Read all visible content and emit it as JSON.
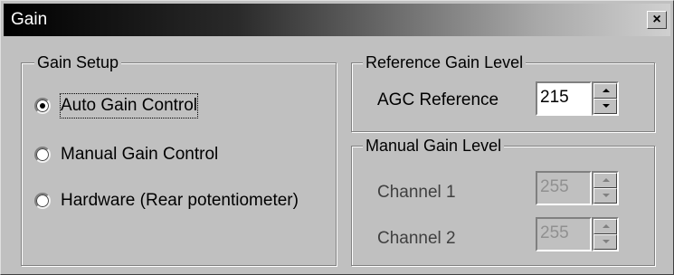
{
  "window": {
    "title": "Gain",
    "close_glyph": "×"
  },
  "gain_setup": {
    "title": "Gain Setup",
    "options": [
      {
        "label": "Auto Gain Control",
        "selected": true
      },
      {
        "label": "Manual Gain Control",
        "selected": false
      },
      {
        "label": "Hardware (Rear potentiometer)",
        "selected": false
      }
    ]
  },
  "reference_gain": {
    "title": "Reference Gain Level",
    "agc_label": "AGC Reference",
    "agc_value": "215"
  },
  "manual_gain": {
    "title": "Manual Gain Level",
    "channel1_label": "Channel 1",
    "channel1_value": "255",
    "channel2_label": "Channel 2",
    "channel2_value": "255"
  },
  "icons": {
    "close": "close-icon",
    "spin_up": "arrow-up-icon",
    "spin_down": "arrow-down-icon"
  }
}
